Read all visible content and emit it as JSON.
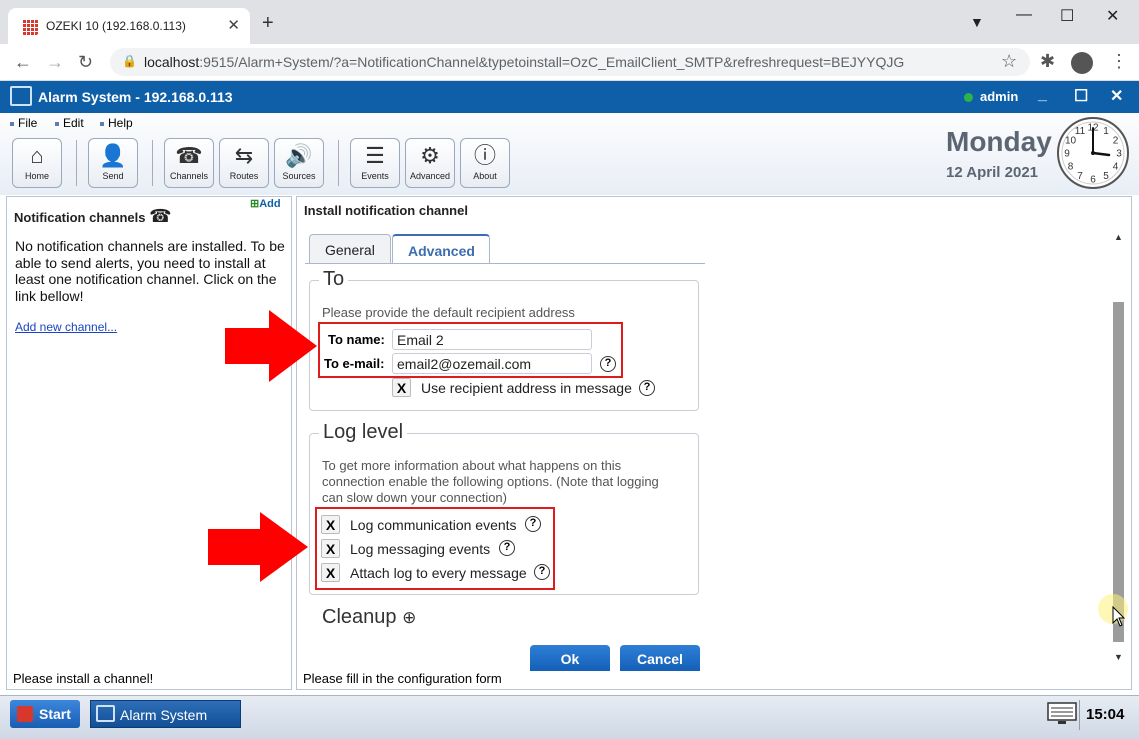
{
  "browser": {
    "tab_title": "OZEKI 10 (192.168.0.113)",
    "url_host": "localhost",
    "url_rest": ":9515/Alarm+System/?a=NotificationChannel&typetoinstall=OzC_EmailClient_SMTP&refreshrequest=BEJYYQJG"
  },
  "app": {
    "title": "Alarm System - 192.168.0.113",
    "user": "admin"
  },
  "menu": [
    "File",
    "Edit",
    "Help"
  ],
  "toolbar": [
    "Home",
    "Send",
    "Channels",
    "Routes",
    "Sources",
    "Events",
    "Advanced",
    "About"
  ],
  "datetime": {
    "day": "Monday",
    "date": "12 April 2021",
    "time": "15:04"
  },
  "clock_numbers": [
    "12",
    "1",
    "2",
    "3",
    "4",
    "5",
    "6",
    "7",
    "8",
    "9",
    "10",
    "11"
  ],
  "left": {
    "title": "Notification channels",
    "add": "Add",
    "message": "No notification channels are installed. To be able to send alerts, you need to install at least one notification channel. Click on the link bellow!",
    "link": "Add new channel...",
    "footer": "Please install a channel!"
  },
  "right": {
    "title": "Install notification channel",
    "tabs": [
      "General",
      "Advanced"
    ],
    "to": {
      "legend": "To",
      "description": "Please provide the default recipient address",
      "name_label": "To name:",
      "name_value": "Email 2",
      "email_label": "To e-mail:",
      "email_value": "email2@ozemail.com",
      "use_recipient": "Use recipient address in message"
    },
    "log": {
      "legend": "Log level",
      "description": "To get more information about what happens on this connection enable the following options. (Note that logging can slow down your connection)",
      "options": [
        "Log communication events",
        "Log messaging events",
        "Attach log to every message"
      ]
    },
    "cleanup": "Cleanup",
    "ok": "Ok",
    "cancel": "Cancel",
    "footer": "Please fill in the configuration form"
  },
  "taskbar": {
    "start": "Start",
    "app": "Alarm System"
  },
  "checkmark": "X",
  "help_mark": "?",
  "colors": {
    "accent": "#0f5ea8",
    "highlight": "#e01b1b",
    "arrow": "#ff0000"
  }
}
